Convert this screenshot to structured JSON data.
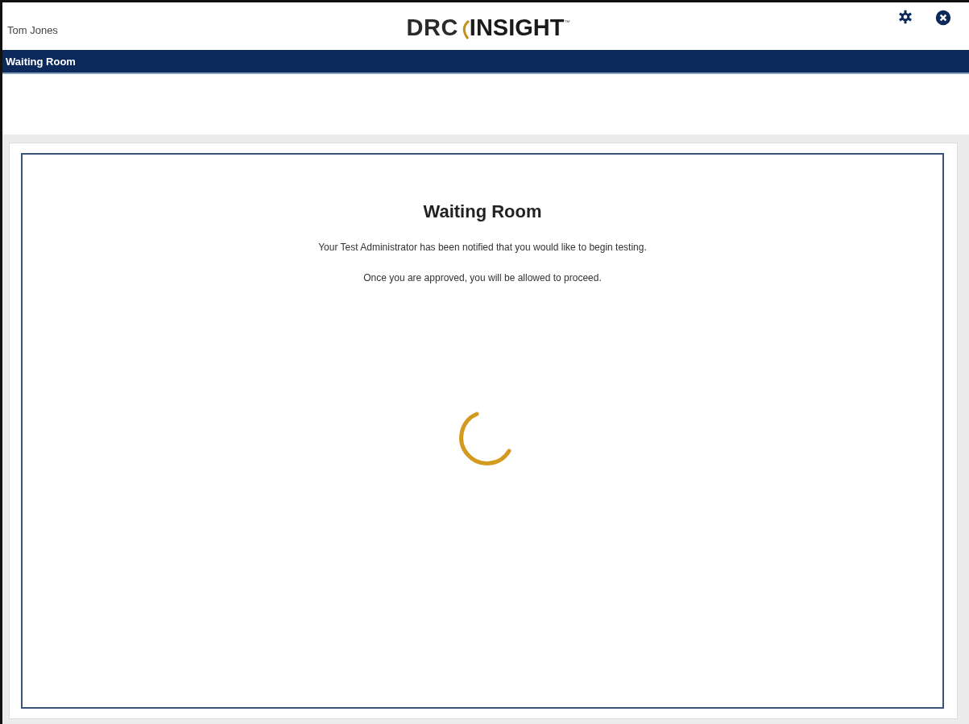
{
  "header": {
    "user_name": "Tom Jones",
    "logo": {
      "part_1": "DRC",
      "part_2": "INSIGHT",
      "mark": "™"
    }
  },
  "nav_bar": {
    "title": "Waiting Room"
  },
  "panel": {
    "title": "Waiting Room",
    "messages": [
      "Your Test Administrator has been notified that you would like to begin testing.",
      "Once you are approved, you will be allowed to proceed."
    ]
  }
}
